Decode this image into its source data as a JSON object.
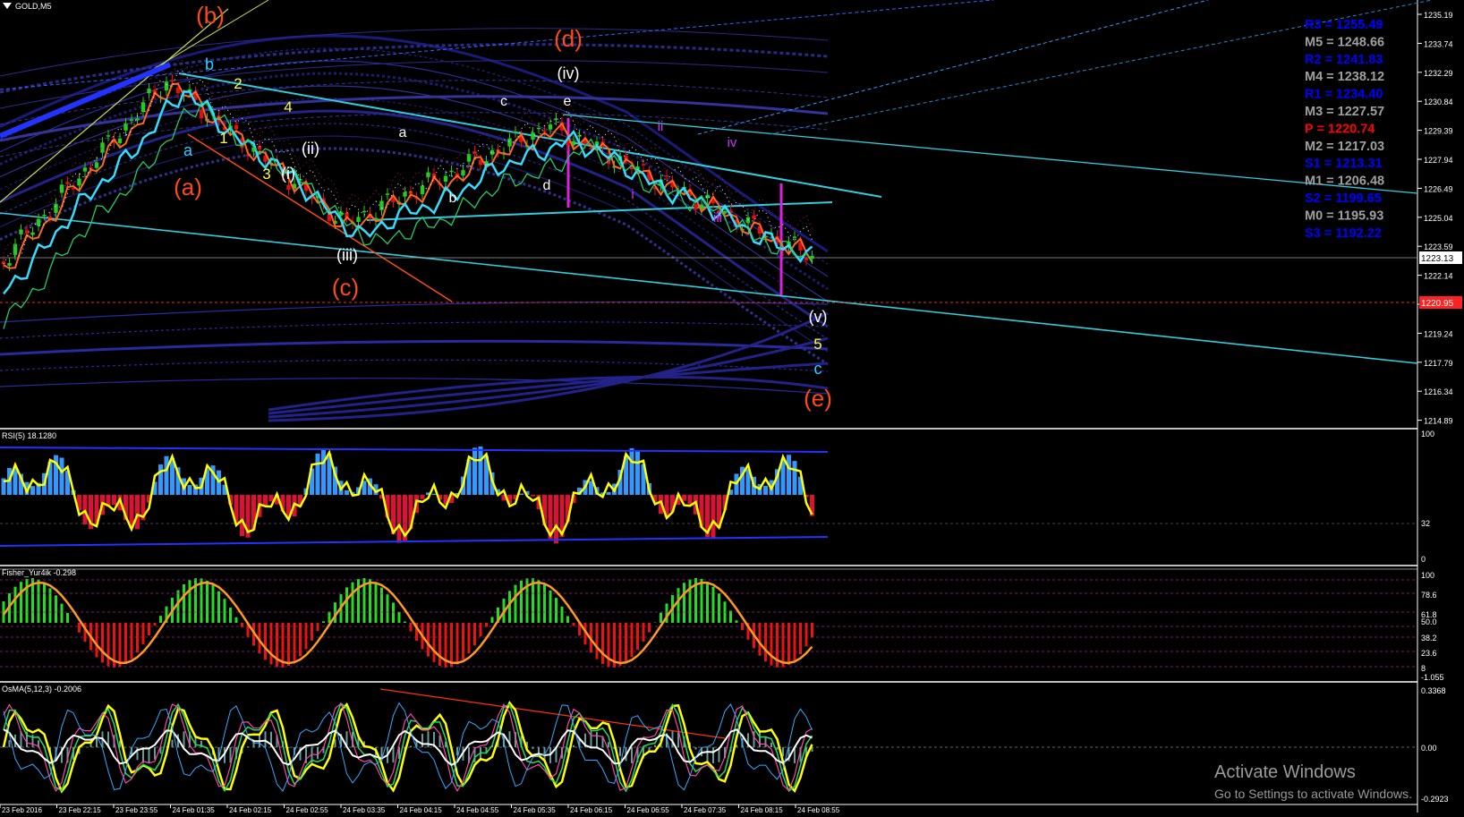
{
  "window": {
    "symbol": "GOLD,M5"
  },
  "colors": {
    "background": "#000000",
    "bull": "#22cc22",
    "bear": "#e01010",
    "wave_major": "#ff4a16",
    "wave_minor": "#ffffff",
    "wave_cyan": "#33ccff",
    "wave_yellow": "#ffff33",
    "wave_magenta": "#cc33ff",
    "trendline": "#33ccdd",
    "pivot_r": "#0000ff",
    "pivot_m": "#a0a0a0",
    "pivot_p": "#ff0000"
  },
  "price_axis": {
    "ticks": [
      "1235.19",
      "1233.74",
      "1232.29",
      "1230.84",
      "1229.39",
      "1227.94",
      "1226.49",
      "1225.04",
      "1223.59",
      "1222.14",
      "1220.69",
      "1219.24",
      "1217.79",
      "1216.34",
      "1214.89"
    ],
    "current_price": "1223.13",
    "level_price": "1220.95"
  },
  "pivots": [
    {
      "label": "R3 = 1255.49",
      "kind": "r"
    },
    {
      "label": "M5 = 1248.66",
      "kind": "m"
    },
    {
      "label": "R2 = 1241.83",
      "kind": "r"
    },
    {
      "label": "M4 = 1238.12",
      "kind": "m"
    },
    {
      "label": "R1 = 1234.40",
      "kind": "r"
    },
    {
      "label": "M3 = 1227.57",
      "kind": "m"
    },
    {
      "label": "P   = 1220.74",
      "kind": "p"
    },
    {
      "label": "M2 = 1217.03",
      "kind": "m"
    },
    {
      "label": "S1 = 1213.31",
      "kind": "r"
    },
    {
      "label": "M1 = 1206.48",
      "kind": "m"
    },
    {
      "label": "S2 = 1199.65",
      "kind": "r"
    },
    {
      "label": "M0 = 1195.93",
      "kind": "m"
    },
    {
      "label": "S3 = 1192.22",
      "kind": "r"
    }
  ],
  "wave_labels": [
    {
      "text": "(b)",
      "color": "major"
    },
    {
      "text": "(a)",
      "color": "major"
    },
    {
      "text": "(c)",
      "color": "major"
    },
    {
      "text": "(d)",
      "color": "major"
    },
    {
      "text": "(e)",
      "color": "major"
    },
    {
      "text": "(iv)",
      "color": "minor"
    },
    {
      "text": "(iii)",
      "color": "minor"
    },
    {
      "text": "(ii)",
      "color": "minor"
    },
    {
      "text": "(i)",
      "color": "minor"
    },
    {
      "text": "(v)",
      "color": "minor"
    },
    {
      "text": "b",
      "color": "cyan"
    },
    {
      "text": "a",
      "color": "cyan"
    },
    {
      "text": "c",
      "color": "cyan"
    },
    {
      "text": "2",
      "color": "yellow"
    },
    {
      "text": "4",
      "color": "yellow"
    },
    {
      "text": "1",
      "color": "yellow"
    },
    {
      "text": "3",
      "color": "yellow"
    },
    {
      "text": "5",
      "color": "yellow"
    },
    {
      "text": "a",
      "color": "minor"
    },
    {
      "text": "b",
      "color": "minor"
    },
    {
      "text": "c",
      "color": "minor"
    },
    {
      "text": "d",
      "color": "minor"
    },
    {
      "text": "e",
      "color": "minor"
    },
    {
      "text": "ii",
      "color": "magenta"
    },
    {
      "text": "iv",
      "color": "magenta"
    },
    {
      "text": "i",
      "color": "magenta"
    },
    {
      "text": "iii",
      "color": "magenta"
    }
  ],
  "indicators": {
    "rsi": {
      "label": "RSI(5) 18.1280",
      "ticks": [
        "100",
        "32",
        "0"
      ]
    },
    "fisher": {
      "label": "Fisher_Yur4ik -0.298",
      "ticks": [
        "100",
        "78.6",
        "61.8",
        "50.0",
        "38.2",
        "23.6",
        "8",
        "-1.055"
      ]
    },
    "osma": {
      "label": "OsMA(5,12,3) -0.2006",
      "ticks": [
        "0.3368",
        "0.00",
        "-0.2923"
      ]
    }
  },
  "time_axis": [
    "23 Feb 2016",
    "23 Feb 22:15",
    "23 Feb 23:55",
    "24 Feb 01:35",
    "24 Feb 02:15",
    "24 Feb 02:55",
    "24 Feb 03:35",
    "24 Feb 04:15",
    "24 Feb 04:55",
    "24 Feb 05:35",
    "24 Feb 06:15",
    "24 Feb 06:55",
    "24 Feb 07:35",
    "24 Feb 08:15",
    "24 Feb 08:55"
  ],
  "watermark": {
    "title": "Activate Windows",
    "subtitle": "Go to Settings to activate Windows."
  }
}
